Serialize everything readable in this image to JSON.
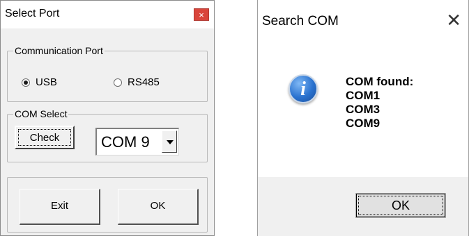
{
  "select_port": {
    "title": "Select Port",
    "close_glyph": "×",
    "communication_port": {
      "legend": "Communication Port",
      "options": [
        {
          "label": "USB",
          "selected": true
        },
        {
          "label": "RS485",
          "selected": false
        }
      ]
    },
    "com_select": {
      "legend": "COM Select",
      "check_label": "Check",
      "com_value": "COM 9"
    },
    "exit_label": "Exit",
    "ok_label": "OK"
  },
  "search_com": {
    "title": "Search COM",
    "close_glyph": "✕",
    "icon": "info-icon",
    "heading": "COM found:",
    "ports": [
      "COM1",
      "COM3",
      "COM9"
    ],
    "ok_label": "OK"
  },
  "colors": {
    "close_button_bg": "#d9453b",
    "info_icon_blue": "#2a72cf",
    "dialog_bg": "#f0f0f0"
  }
}
